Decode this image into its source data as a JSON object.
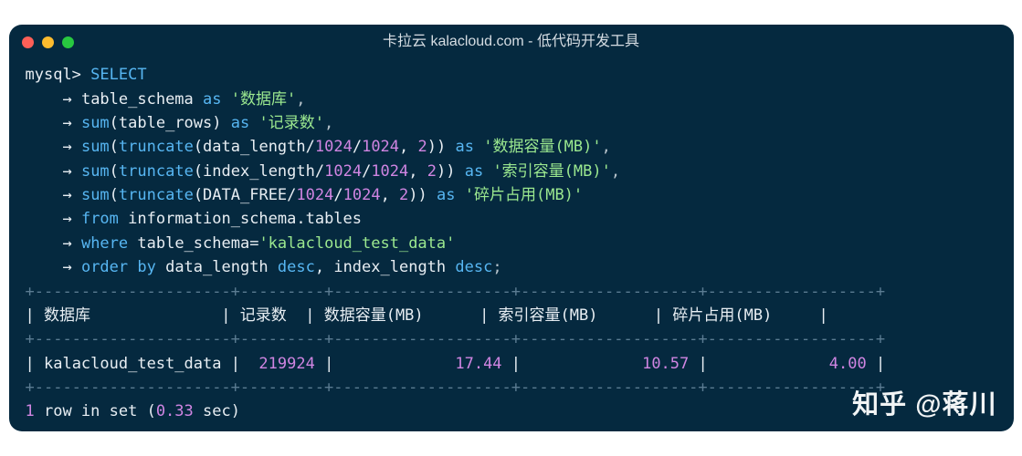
{
  "window": {
    "title": "卡拉云 kalacloud.com - 低代码开发工具"
  },
  "prompt": "mysql>",
  "arrow": "→",
  "query": {
    "l0": "SELECT",
    "l1_a": "table_schema ",
    "l1_as": "as",
    "l1_s": " '数据库'",
    "comma": ",",
    "l2_a": "sum",
    "l2_b": "(table_rows) ",
    "l2_as": "as",
    "l2_s": " '记录数'",
    "l3_a": "sum",
    "l3_b": "(",
    "l3_c": "truncate",
    "l3_d": "(data_length/",
    "k1024": "1024",
    "slash": "/",
    "cm": ", ",
    "two": "2",
    "rp": ")) ",
    "as": "as",
    "l3_s": " '数据容量(MB)'",
    "l4_d": "(index_length/",
    "l4_s": " '索引容量(MB)'",
    "l5_d": "(DATA_FREE/",
    "l5_s": " '碎片占用(MB)'",
    "l6_a": "from",
    "l6_b": " information_schema.tables",
    "l7_a": "where",
    "l7_b": " table_schema=",
    "l7_s": "'kalacloud_test_data'",
    "l8_a": "order by",
    "l8_b": " data_length ",
    "l8_c": "desc",
    "l8_d": ", index_length ",
    "l8_e": "desc",
    "semi": ";"
  },
  "table": {
    "border": "+---------------------+--------+---------------+---------------+---------------+",
    "h1": "数据库",
    "h2": "记录数",
    "h3": "数据容量(MB)",
    "h4": "索引容量(MB)",
    "h5": "碎片占用(MB)",
    "r1c1": "kalacloud_test_data",
    "r1c2": "219924",
    "r1c3": "17.44",
    "r1c4": "10.57",
    "r1c5": "4.00"
  },
  "footer": {
    "count": "1",
    "text_a": " row in set (",
    "time": "0.33",
    "text_b": " sec)"
  },
  "watermark": "知乎 @蒋川"
}
